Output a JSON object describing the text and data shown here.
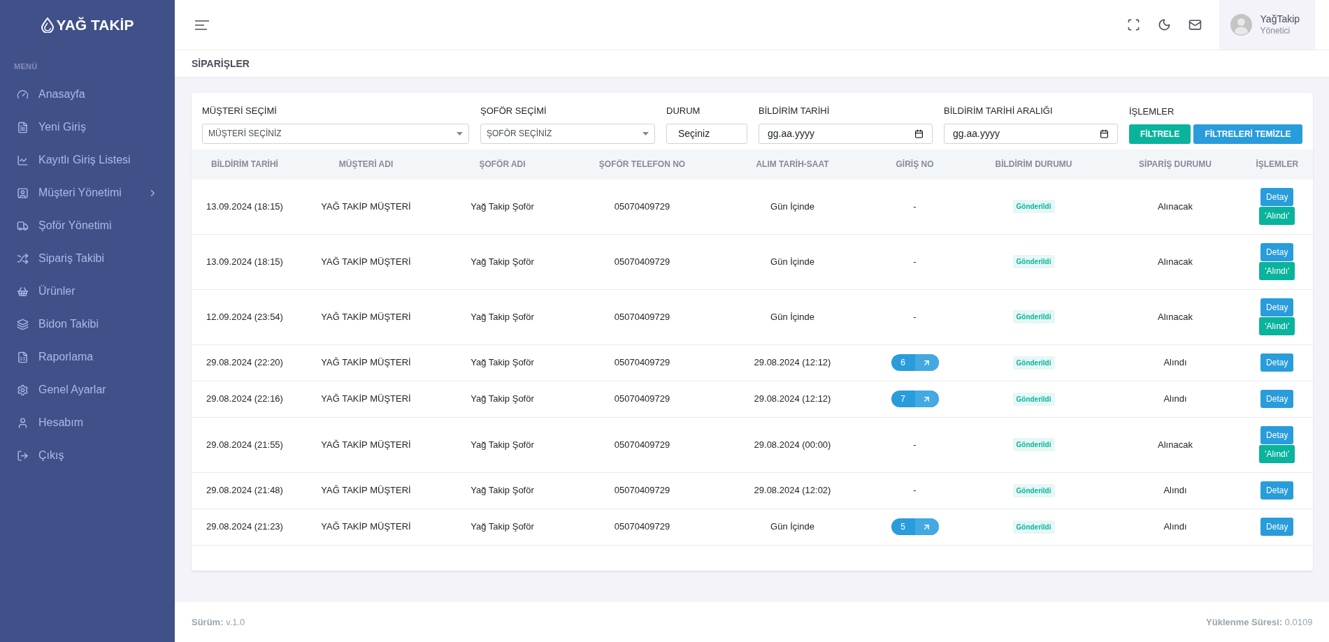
{
  "brand": "YAĞ TAKİP",
  "sidebar": {
    "section_title": "MENÜ",
    "items": [
      {
        "label": "Anasayfa",
        "has_submenu": false
      },
      {
        "label": "Yeni Giriş",
        "has_submenu": false
      },
      {
        "label": "Kayıtlı Giriş Listesi",
        "has_submenu": false
      },
      {
        "label": "Müşteri Yönetimi",
        "has_submenu": true
      },
      {
        "label": "Şoför Yönetimi",
        "has_submenu": false
      },
      {
        "label": "Sipariş Takibi",
        "has_submenu": false
      },
      {
        "label": "Ürünler",
        "has_submenu": false
      },
      {
        "label": "Bidon Takibi",
        "has_submenu": false
      },
      {
        "label": "Raporlama",
        "has_submenu": false
      },
      {
        "label": "Genel Ayarlar",
        "has_submenu": false
      },
      {
        "label": "Hesabım",
        "has_submenu": false
      },
      {
        "label": "Çıkış",
        "has_submenu": false
      }
    ]
  },
  "user": {
    "name": "YağTakip",
    "role": "Yönetici"
  },
  "page_title": "SİPARİŞLER",
  "filters": [
    {
      "kind": "select",
      "label": "MÜŞTERİ SEÇİMİ",
      "value": "MÜŞTERİ SEÇİNİZ"
    },
    {
      "kind": "select",
      "label": "ŞOFÖR SEÇİMİ",
      "value": "ŞOFÖR SEÇİNİZ"
    },
    {
      "kind": "text",
      "label": "DURUM",
      "value": "Seçiniz"
    },
    {
      "kind": "date",
      "label": "BİLDİRİM TARİHİ",
      "placeholder": "gg.aa.yyyy"
    },
    {
      "kind": "date",
      "label": "BİLDİRİM TARİHİ ARALIĞI",
      "placeholder": "gg.aa.yyyy"
    }
  ],
  "actions": {
    "label": "İŞLEMLER",
    "buttons": [
      {
        "kind": "filter",
        "text": "FİLTRELE"
      },
      {
        "kind": "clear",
        "text": "FİLTRELERİ TEMİZLE"
      }
    ]
  },
  "table": {
    "columns": [
      "BİLDİRİM TARİHİ",
      "MÜŞTERİ ADI",
      "ŞOFÖR ADI",
      "ŞOFÖR TELEFON NO",
      "ALIM TARİH-SAAT",
      "GİRİŞ NO",
      "BİLDİRİM DURUMU",
      "SİPARİŞ DURUMU",
      "İŞLEMLER"
    ],
    "rows": [
      {
        "date": "13.09.2024 (18:15)",
        "customer": "YAĞ TAKİP MÜŞTERİ",
        "driver": "Yağ Takip Şoför",
        "phone": "05070409729",
        "pickup": "Gün İçinde",
        "entry": {
          "kind": "none",
          "text": "-"
        },
        "notification": "Gönderildi",
        "status": "Alınacak",
        "buttons": [
          {
            "kind": "detail",
            "text": "Detay"
          },
          {
            "kind": "received",
            "text": "'Alındı'"
          }
        ]
      },
      {
        "date": "13.09.2024 (18:15)",
        "customer": "YAĞ TAKİP MÜŞTERİ",
        "driver": "Yağ Takip Şoför",
        "phone": "05070409729",
        "pickup": "Gün İçinde",
        "entry": {
          "kind": "none",
          "text": "-"
        },
        "notification": "Gönderildi",
        "status": "Alınacak",
        "buttons": [
          {
            "kind": "detail",
            "text": "Detay"
          },
          {
            "kind": "received",
            "text": "'Alındı'"
          }
        ]
      },
      {
        "date": "12.09.2024 (23:54)",
        "customer": "YAĞ TAKİP MÜŞTERİ",
        "driver": "Yağ Takip Şoför",
        "phone": "05070409729",
        "pickup": "Gün İçinde",
        "entry": {
          "kind": "none",
          "text": "-"
        },
        "notification": "Gönderildi",
        "status": "Alınacak",
        "buttons": [
          {
            "kind": "detail",
            "text": "Detay"
          },
          {
            "kind": "received",
            "text": "'Alındı'"
          }
        ]
      },
      {
        "date": "29.08.2024 (22:20)",
        "customer": "YAĞ TAKİP MÜŞTERİ",
        "driver": "Yağ Takip Şoför",
        "phone": "05070409729",
        "pickup": "29.08.2024 (12:12)",
        "entry": {
          "kind": "link",
          "text": "6"
        },
        "notification": "Gönderildi",
        "status": "Alındı",
        "buttons": [
          {
            "kind": "detail",
            "text": "Detay"
          }
        ]
      },
      {
        "date": "29.08.2024 (22:16)",
        "customer": "YAĞ TAKİP MÜŞTERİ",
        "driver": "Yağ Takip Şoför",
        "phone": "05070409729",
        "pickup": "29.08.2024 (12:12)",
        "entry": {
          "kind": "link",
          "text": "7"
        },
        "notification": "Gönderildi",
        "status": "Alındı",
        "buttons": [
          {
            "kind": "detail",
            "text": "Detay"
          }
        ]
      },
      {
        "date": "29.08.2024 (21:55)",
        "customer": "YAĞ TAKİP MÜŞTERİ",
        "driver": "Yağ Takip Şoför",
        "phone": "05070409729",
        "pickup": "29.08.2024 (00:00)",
        "entry": {
          "kind": "none",
          "text": "-"
        },
        "notification": "Gönderildi",
        "status": "Alınacak",
        "buttons": [
          {
            "kind": "detail",
            "text": "Detay"
          },
          {
            "kind": "received",
            "text": "'Alındı'"
          }
        ]
      },
      {
        "date": "29.08.2024 (21:48)",
        "customer": "YAĞ TAKİP MÜŞTERİ",
        "driver": "Yağ Takip Şoför",
        "phone": "05070409729",
        "pickup": "29.08.2024 (12:02)",
        "entry": {
          "kind": "none",
          "text": "-"
        },
        "notification": "Gönderildi",
        "status": "Alındı",
        "buttons": [
          {
            "kind": "detail",
            "text": "Detay"
          }
        ]
      },
      {
        "date": "29.08.2024 (21:23)",
        "customer": "YAĞ TAKİP MÜŞTERİ",
        "driver": "Yağ Takip Şoför",
        "phone": "05070409729",
        "pickup": "Gün İçinde",
        "entry": {
          "kind": "link",
          "text": "5"
        },
        "notification": "Gönderildi",
        "status": "Alındı",
        "buttons": [
          {
            "kind": "detail",
            "text": "Detay"
          }
        ]
      }
    ]
  },
  "footer": {
    "version_label": "Sürüm:",
    "version": "v.1.0",
    "load_label": "Yüklenme Süresi:",
    "load_time": "0.0109"
  }
}
